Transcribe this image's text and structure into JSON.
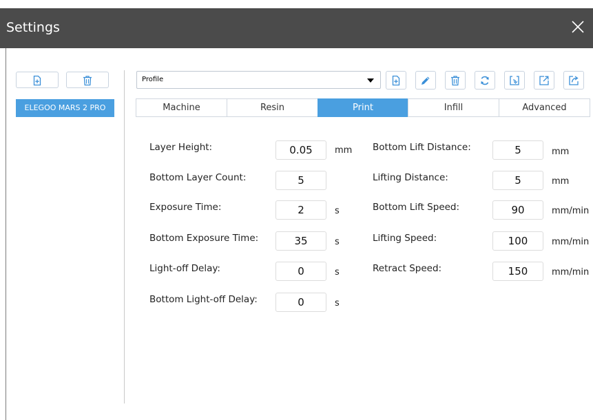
{
  "window": {
    "title": "Settings"
  },
  "left_panel": {
    "machine_label": "ELEGOO MARS 2 PRO"
  },
  "profile": {
    "selected": "Profile"
  },
  "tabs": [
    {
      "label": "Machine"
    },
    {
      "label": "Resin"
    },
    {
      "label": "Print"
    },
    {
      "label": "Infill"
    },
    {
      "label": "Advanced"
    }
  ],
  "left_fields": [
    {
      "label": "Layer Height:",
      "value": "0.05",
      "unit": "mm"
    },
    {
      "label": "Bottom Layer Count:",
      "value": "5",
      "unit": ""
    },
    {
      "label": "Exposure Time:",
      "value": "2",
      "unit": "s"
    },
    {
      "label": "Bottom Exposure Time:",
      "value": "35",
      "unit": "s"
    },
    {
      "label": "Light-off Delay:",
      "value": "0",
      "unit": "s"
    },
    {
      "label": "Bottom Light-off Delay:",
      "value": "0",
      "unit": "s"
    }
  ],
  "right_fields": [
    {
      "label": "Bottom Lift Distance:",
      "value": "5",
      "unit": "mm"
    },
    {
      "label": "Lifting Distance:",
      "value": "5",
      "unit": "mm"
    },
    {
      "label": "Bottom Lift Speed:",
      "value": "90",
      "unit": "mm/min"
    },
    {
      "label": "Lifting Speed:",
      "value": "100",
      "unit": "mm/min"
    },
    {
      "label": "Retract Speed:",
      "value": "150",
      "unit": "mm/min"
    }
  ],
  "colors": {
    "titlebar": "#4b4b4b",
    "accent": "#4a9fe0",
    "icon_blue": "#3a8fd8"
  },
  "icons": {
    "left_toolbar": [
      "add-file-icon",
      "trash-icon"
    ],
    "profile_toolbar": [
      "add-file-icon",
      "pencil-icon",
      "trash-icon",
      "refresh-icon",
      "import-icon",
      "export-icon",
      "share-icon"
    ]
  }
}
